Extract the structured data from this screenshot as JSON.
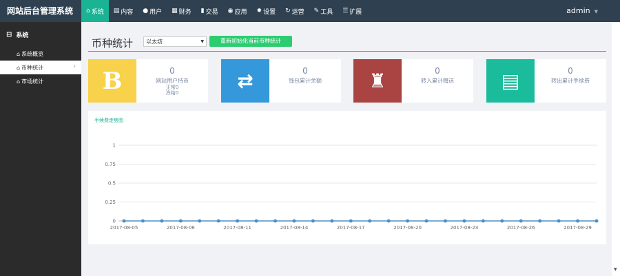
{
  "brand": "网站后台管理系统",
  "nav": [
    {
      "icon": "home-icon",
      "glyph": "⌂",
      "label": "系统"
    },
    {
      "icon": "content-icon",
      "glyph": "▤",
      "label": "内容"
    },
    {
      "icon": "user-icon",
      "glyph": "●",
      "label": "用户"
    },
    {
      "icon": "finance-icon",
      "glyph": "▦",
      "label": "财务"
    },
    {
      "icon": "trade-icon",
      "glyph": "▮",
      "label": "交易"
    },
    {
      "icon": "app-icon",
      "glyph": "◉",
      "label": "应用"
    },
    {
      "icon": "settings-icon",
      "glyph": "✹",
      "label": "设置"
    },
    {
      "icon": "operation-icon",
      "glyph": "↻",
      "label": "运营"
    },
    {
      "icon": "tools-icon",
      "glyph": "✎",
      "label": "工具"
    },
    {
      "icon": "extend-icon",
      "glyph": "☰",
      "label": "扩展"
    }
  ],
  "user": {
    "name": "admin",
    "caret": "▼"
  },
  "sidebar": {
    "section_glyph": "⊟",
    "section": "系统",
    "items": [
      {
        "glyph": "⌂",
        "label": "系统概览"
      },
      {
        "glyph": "⌂",
        "label": "币种统计",
        "arrow": "›"
      },
      {
        "glyph": "⌂",
        "label": "市场统计"
      }
    ]
  },
  "page": {
    "title": "币种统计",
    "select_value": "以太坊",
    "select_caret": "▼",
    "reinit_label": "重新初始化当前币种统计"
  },
  "cards": [
    {
      "color": "#f7d24a",
      "glyph": "B",
      "value": "0",
      "label": "网站用户持币",
      "subs": [
        "正常0",
        "冻结0"
      ]
    },
    {
      "color": "#3498db",
      "glyph": "⇄",
      "value": "0",
      "label": "钱包累计余额",
      "subs": []
    },
    {
      "color": "#a94442",
      "glyph": "♜",
      "value": "0",
      "label": "转入累计赠送",
      "subs": []
    },
    {
      "color": "#1abc9c",
      "glyph": "▤",
      "value": "0",
      "label": "转出累计手续费",
      "subs": []
    }
  ],
  "chart_title": "手续费走势图",
  "chart_data": {
    "type": "line",
    "title": "手续费走势图",
    "ylim": [
      0,
      1
    ],
    "yticks": [
      "0",
      "0.25",
      "0.5",
      "0.75",
      "1"
    ],
    "x": [
      "2017-08-05",
      "2017-08-06",
      "2017-08-07",
      "2017-08-08",
      "2017-08-09",
      "2017-08-10",
      "2017-08-11",
      "2017-08-12",
      "2017-08-13",
      "2017-08-14",
      "2017-08-15",
      "2017-08-16",
      "2017-08-17",
      "2017-08-18",
      "2017-08-19",
      "2017-08-20",
      "2017-08-21",
      "2017-08-22",
      "2017-08-23",
      "2017-08-24",
      "2017-08-25",
      "2017-08-26",
      "2017-08-27",
      "2017-08-28",
      "2017-08-29",
      "2017-08-30"
    ],
    "xtick_labels": [
      "2017-08-05",
      "2017-08-08",
      "2017-08-11",
      "2017-08-14",
      "2017-08-17",
      "2017-08-20",
      "2017-08-23",
      "2017-08-26",
      "2017-08-29"
    ],
    "values": [
      0,
      0,
      0,
      0,
      0,
      0,
      0,
      0,
      0,
      0,
      0,
      0,
      0,
      0,
      0,
      0,
      0,
      0,
      0,
      0,
      0,
      0,
      0,
      0,
      0,
      0
    ],
    "grid": true,
    "color": "#4a90c8"
  },
  "scroll_arrow": "▼"
}
